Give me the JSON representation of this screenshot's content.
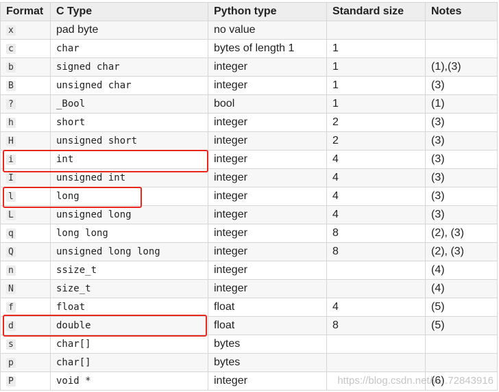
{
  "headers": [
    "Format",
    "C Type",
    "Python type",
    "Standard size",
    "Notes"
  ],
  "rows": [
    [
      "x",
      "pad byte",
      "no value",
      "",
      ""
    ],
    [
      "c",
      "char",
      "bytes of length 1",
      "1",
      ""
    ],
    [
      "b",
      "signed char",
      "integer",
      "1",
      "(1),(3)"
    ],
    [
      "B",
      "unsigned char",
      "integer",
      "1",
      "(3)"
    ],
    [
      "?",
      "_Bool",
      "bool",
      "1",
      "(1)"
    ],
    [
      "h",
      "short",
      "integer",
      "2",
      "(3)"
    ],
    [
      "H",
      "unsigned short",
      "integer",
      "2",
      "(3)"
    ],
    [
      "i",
      "int",
      "integer",
      "4",
      "(3)"
    ],
    [
      "I",
      "unsigned int",
      "integer",
      "4",
      "(3)"
    ],
    [
      "l",
      "long",
      "integer",
      "4",
      "(3)"
    ],
    [
      "L",
      "unsigned long",
      "integer",
      "4",
      "(3)"
    ],
    [
      "q",
      "long long",
      "integer",
      "8",
      "(2), (3)"
    ],
    [
      "Q",
      "unsigned long long",
      "integer",
      "8",
      "(2), (3)"
    ],
    [
      "n",
      "ssize_t",
      "integer",
      "",
      "(4)"
    ],
    [
      "N",
      "size_t",
      "integer",
      "",
      "(4)"
    ],
    [
      "f",
      "float",
      "float",
      "4",
      "(5)"
    ],
    [
      "d",
      "double",
      "float",
      "8",
      "(5)"
    ],
    [
      "s",
      "char[]",
      "bytes",
      "",
      ""
    ],
    [
      "p",
      "char[]",
      "bytes",
      "",
      ""
    ],
    [
      "P",
      "void *",
      "integer",
      "",
      "(6)"
    ]
  ],
  "highlighted_formats": [
    "i",
    "l",
    "d"
  ],
  "highlight_color": "#e8261b",
  "watermark": "https://blog.csdn.net/w...72843916"
}
